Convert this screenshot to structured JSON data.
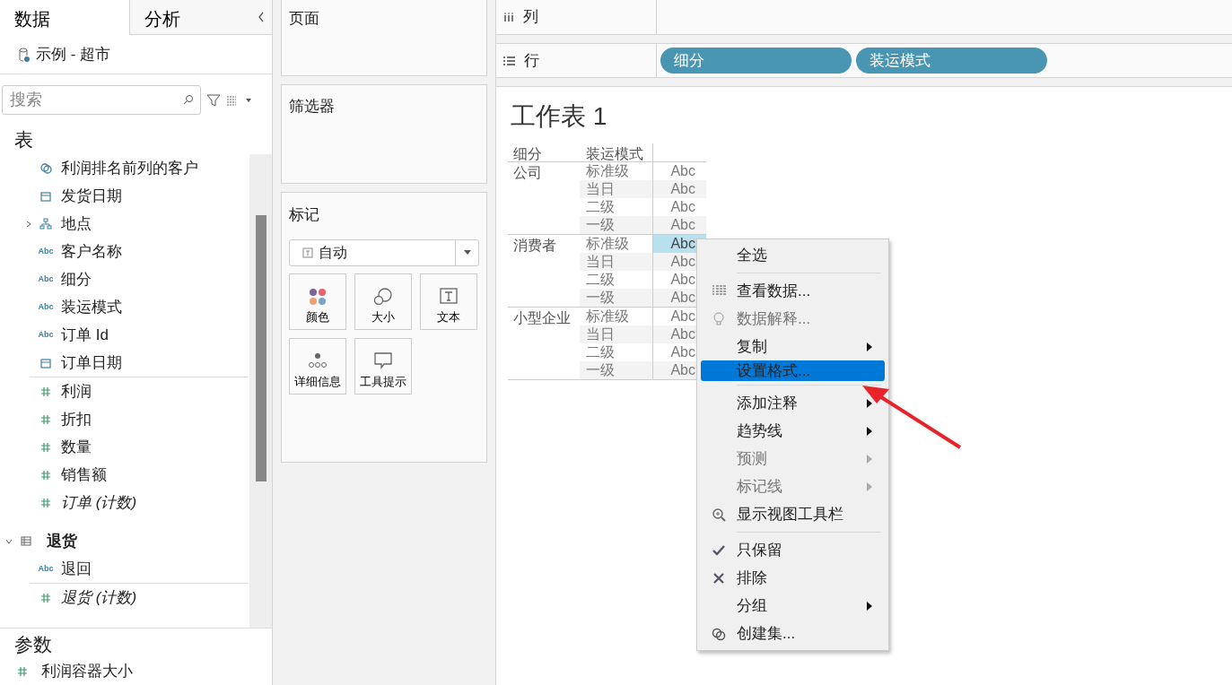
{
  "data_pane": {
    "tabs": [
      {
        "label": "数据",
        "selected": true
      },
      {
        "label": "分析",
        "selected": false
      }
    ],
    "datasource": "示例 - 超市",
    "search": {
      "placeholder": "搜索"
    },
    "section_title": "表",
    "tables": [
      {
        "fields": [
          {
            "label": "利润排名前列的客户",
            "kind": "set",
            "italic": false
          },
          {
            "label": "发货日期",
            "kind": "date",
            "italic": false
          },
          {
            "label": "地点",
            "kind": "geo",
            "italic": false,
            "expanded": false
          },
          {
            "label": "客户名称",
            "kind": "string",
            "type_text": "Abc",
            "italic": false
          },
          {
            "label": "细分",
            "kind": "string",
            "type_text": "Abc",
            "italic": false
          },
          {
            "label": "装运模式",
            "kind": "string",
            "type_text": "Abc",
            "italic": false
          },
          {
            "label": "订单 Id",
            "kind": "string",
            "type_text": "Abc",
            "italic": false
          },
          {
            "label": "订单日期",
            "kind": "date",
            "italic": false
          }
        ],
        "measures": [
          {
            "label": "利润",
            "kind": "number",
            "italic": false
          },
          {
            "label": "折扣",
            "kind": "number",
            "italic": false
          },
          {
            "label": "数量",
            "kind": "number",
            "italic": false
          },
          {
            "label": "销售额",
            "kind": "number",
            "italic": false
          },
          {
            "label": "订单 (计数)",
            "kind": "number",
            "italic": true
          }
        ]
      },
      {
        "name": "退货",
        "expanded": true,
        "fields": [
          {
            "label": "退回",
            "kind": "string",
            "type_text": "Abc",
            "italic": false
          }
        ],
        "measures": [
          {
            "label": "退货 (计数)",
            "kind": "number",
            "italic": true
          }
        ]
      }
    ],
    "parameters": {
      "title": "参数",
      "items": [
        {
          "label": "利润容器大小",
          "kind": "number"
        }
      ]
    }
  },
  "shelves": {
    "pages": "页面",
    "filters": "筛选器"
  },
  "marks": {
    "title": "标记",
    "type": "自动",
    "buttons": [
      {
        "label": "颜色",
        "kind": "color"
      },
      {
        "label": "大小",
        "kind": "size"
      },
      {
        "label": "文本",
        "kind": "text"
      },
      {
        "label": "详细信息",
        "kind": "detail"
      },
      {
        "label": "工具提示",
        "kind": "tooltip"
      }
    ]
  },
  "columns_shelf": {
    "label": "列"
  },
  "rows_shelf": {
    "label": "行",
    "pills": [
      "细分",
      "装运模式"
    ]
  },
  "sheet": {
    "title": "工作表 1",
    "headers": [
      "细分",
      "装运模式"
    ],
    "groups": [
      {
        "segment": "公司",
        "rows": [
          {
            "mode": "标准级",
            "value": "Abc",
            "selected": false
          },
          {
            "mode": "当日",
            "value": "Abc",
            "selected": false
          },
          {
            "mode": "二级",
            "value": "Abc",
            "selected": false
          },
          {
            "mode": "一级",
            "value": "Abc",
            "selected": false
          }
        ]
      },
      {
        "segment": "消费者",
        "rows": [
          {
            "mode": "标准级",
            "value": "Abc",
            "selected": true
          },
          {
            "mode": "当日",
            "value": "Abc",
            "selected": false
          },
          {
            "mode": "二级",
            "value": "Abc",
            "selected": false
          },
          {
            "mode": "一级",
            "value": "Abc",
            "selected": false
          }
        ]
      },
      {
        "segment": "小型企业",
        "rows": [
          {
            "mode": "标准级",
            "value": "Abc",
            "selected": false
          },
          {
            "mode": "当日",
            "value": "Abc",
            "selected": false
          },
          {
            "mode": "二级",
            "value": "Abc",
            "selected": false
          },
          {
            "mode": "一级",
            "value": "Abc",
            "selected": false
          }
        ]
      }
    ]
  },
  "context_menu": {
    "groups": [
      [
        {
          "label": "全选",
          "submenu": false,
          "disabled": false,
          "selected": false
        }
      ],
      [
        {
          "label": "查看数据...",
          "kind": "data",
          "submenu": false,
          "disabled": false,
          "selected": false
        },
        {
          "label": "数据解释...",
          "kind": "explain",
          "submenu": false,
          "disabled": true,
          "selected": false
        },
        {
          "label": "复制",
          "submenu": true,
          "disabled": false,
          "selected": false
        },
        {
          "label": "设置格式...",
          "submenu": false,
          "disabled": false,
          "selected": true
        }
      ],
      [
        {
          "label": "添加注释",
          "submenu": true,
          "disabled": false,
          "selected": false
        },
        {
          "label": "趋势线",
          "submenu": true,
          "disabled": false,
          "selected": false
        },
        {
          "label": "预测",
          "submenu": true,
          "disabled": true,
          "selected": false
        },
        {
          "label": "标记线",
          "submenu": true,
          "disabled": true,
          "selected": false
        },
        {
          "label": "显示视图工具栏",
          "kind": "toolbar",
          "submenu": false,
          "disabled": false,
          "selected": false
        }
      ],
      [
        {
          "label": "只保留",
          "kind": "keep",
          "submenu": false,
          "disabled": false,
          "selected": false
        },
        {
          "label": "排除",
          "kind": "exclude",
          "submenu": false,
          "disabled": false,
          "selected": false
        },
        {
          "label": "分组",
          "submenu": true,
          "disabled": false,
          "selected": false
        },
        {
          "label": "创建集...",
          "kind": "set",
          "submenu": false,
          "disabled": false,
          "selected": false
        }
      ]
    ]
  }
}
